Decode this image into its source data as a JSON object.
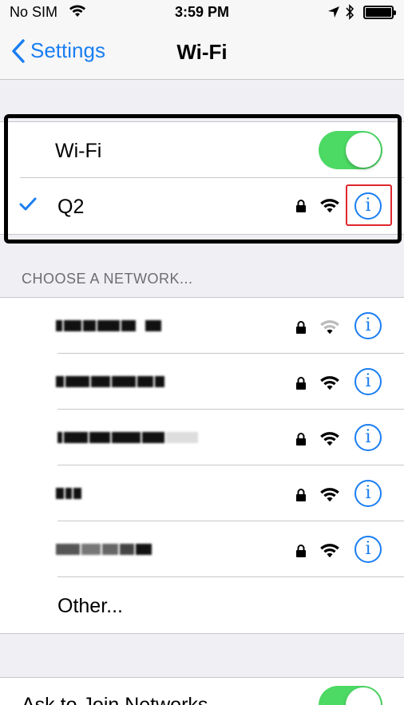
{
  "status_bar": {
    "carrier": "No SIM",
    "time": "3:59 PM",
    "wifi_icon": "wifi-icon",
    "location_icon": "location-arrow-icon",
    "bluetooth_icon": "bluetooth-icon",
    "battery_icon": "battery-icon"
  },
  "nav": {
    "back_label": "Settings",
    "title": "Wi-Fi"
  },
  "wifi_section": {
    "toggle_label": "Wi-Fi",
    "toggle_on": true,
    "connected_network": "Q2",
    "connected_secured": true,
    "info_icon_glyph": "i"
  },
  "choose_header": "CHOOSE A NETWORK...",
  "networks": [
    {
      "name": "",
      "secured": true,
      "signal": "weak",
      "obscured": true
    },
    {
      "name": "",
      "secured": true,
      "signal": "strong",
      "obscured": true
    },
    {
      "name": "",
      "secured": true,
      "signal": "strong",
      "obscured": true
    },
    {
      "name": "",
      "secured": true,
      "signal": "strong",
      "obscured": true
    },
    {
      "name": "",
      "secured": true,
      "signal": "strong",
      "obscured": true
    }
  ],
  "other_label": "Other...",
  "ask_to_join_label": "Ask to Join Networks",
  "colors": {
    "accent": "#1a7ef2",
    "toggle_on": "#4cd964",
    "background": "#efeff4",
    "separator": "#c8c7cc",
    "highlight_red": "#e0262c"
  }
}
